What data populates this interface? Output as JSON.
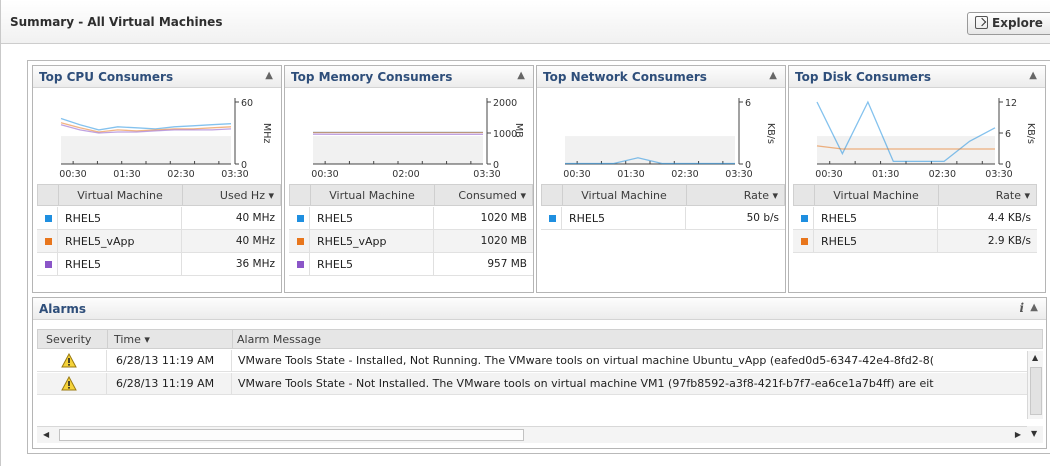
{
  "header": {
    "title": "Summary - All Virtual Machines",
    "explore_label": "Explore"
  },
  "panels": [
    {
      "title": "Top CPU Consumers",
      "col1": "Virtual Machine",
      "col2": "Used Hz ▾",
      "rows": [
        {
          "name": "RHEL5",
          "value": "40 MHz",
          "color": "#1f8fe0"
        },
        {
          "name": "RHEL5_vApp",
          "value": "40 MHz",
          "color": "#e8761d"
        },
        {
          "name": "RHEL5",
          "value": "36 MHz",
          "color": "#8b56c8"
        }
      ]
    },
    {
      "title": "Top Memory Consumers",
      "col1": "Virtual Machine",
      "col2": "Consumed ▾",
      "rows": [
        {
          "name": "RHEL5",
          "value": "1020 MB",
          "color": "#1f8fe0"
        },
        {
          "name": "RHEL5_vApp",
          "value": "1020 MB",
          "color": "#e8761d"
        },
        {
          "name": "RHEL5",
          "value": "957 MB",
          "color": "#8b56c8"
        }
      ]
    },
    {
      "title": "Top Network Consumers",
      "col1": "Virtual Machine",
      "col2": "Rate ▾",
      "rows": [
        {
          "name": "RHEL5",
          "value": "50 b/s",
          "color": "#1f8fe0"
        }
      ]
    },
    {
      "title": "Top Disk Consumers",
      "col1": "Virtual Machine",
      "col2": "Rate ▾",
      "rows": [
        {
          "name": "RHEL5",
          "value": "4.4 KB/s",
          "color": "#1f8fe0"
        },
        {
          "name": "RHEL5",
          "value": "2.9 KB/s",
          "color": "#e8761d"
        }
      ]
    }
  ],
  "chart_data": [
    {
      "type": "line",
      "x": [
        "00:15",
        "00:30",
        "00:45",
        "01:00",
        "01:30",
        "02:00",
        "02:30",
        "03:00",
        "03:30",
        "03:45"
      ],
      "xticks": [
        "00:30",
        "01:30",
        "02:30",
        "03:30"
      ],
      "ylabel": "MHz",
      "ylim": [
        0,
        60
      ],
      "yticks": [
        "60",
        "0"
      ],
      "series": [
        {
          "color": "#1f8fe0",
          "values": [
            44,
            38,
            33,
            36,
            35,
            34,
            36,
            37,
            38,
            39
          ]
        },
        {
          "color": "#e8761d",
          "values": [
            40,
            35,
            31,
            33,
            32,
            33,
            34,
            34,
            35,
            36
          ]
        },
        {
          "color": "#8b56c8",
          "values": [
            38,
            33,
            30,
            31,
            31,
            32,
            33,
            33,
            33,
            34
          ]
        }
      ]
    },
    {
      "type": "line",
      "x": [
        "00:15",
        "00:30",
        "01:00",
        "01:30",
        "02:00",
        "02:30",
        "03:00",
        "03:30"
      ],
      "xticks": [
        "00:30",
        "02:00",
        "03:30"
      ],
      "ylabel": "MB",
      "ylim": [
        0,
        2000
      ],
      "yticks": [
        "2000",
        "1000",
        "0"
      ],
      "series": [
        {
          "color": "#1f8fe0",
          "values": [
            1020,
            1020,
            1020,
            1020,
            1020,
            1020,
            1020,
            1020
          ]
        },
        {
          "color": "#e8761d",
          "values": [
            1015,
            1015,
            1015,
            1015,
            1015,
            1015,
            1015,
            1015
          ]
        },
        {
          "color": "#8b56c8",
          "values": [
            960,
            958,
            957,
            957,
            957,
            957,
            957,
            957
          ]
        }
      ]
    },
    {
      "type": "line",
      "x": [
        "00:15",
        "00:30",
        "01:00",
        "01:30",
        "02:00",
        "02:30",
        "03:00",
        "03:30"
      ],
      "xticks": [
        "00:30",
        "01:30",
        "02:30",
        "03:30"
      ],
      "ylabel": "KB/s",
      "ylim": [
        0,
        6
      ],
      "yticks": [
        "6",
        "0"
      ],
      "series": [
        {
          "color": "#1f8fe0",
          "values": [
            0.05,
            0.05,
            0.05,
            0.6,
            0.05,
            0.05,
            0.05,
            0.05
          ]
        }
      ]
    },
    {
      "type": "line",
      "x": [
        "00:15",
        "00:30",
        "01:00",
        "01:30",
        "02:00",
        "02:30",
        "03:00",
        "03:30"
      ],
      "xticks": [
        "00:30",
        "01:30",
        "02:30",
        "03:30"
      ],
      "ylabel": "KB/s",
      "ylim": [
        0,
        12
      ],
      "yticks": [
        "12",
        "6",
        "0"
      ],
      "series": [
        {
          "color": "#1f8fe0",
          "values": [
            12,
            2,
            12,
            0.5,
            0.5,
            0.5,
            4.4,
            7
          ]
        },
        {
          "color": "#e8761d",
          "values": [
            3.5,
            2.9,
            2.9,
            2.9,
            2.9,
            2.9,
            2.9,
            2.9
          ]
        }
      ]
    }
  ],
  "alarms": {
    "title": "Alarms",
    "info_label": "i",
    "columns": [
      "Severity",
      "Time ▾",
      "Alarm Message"
    ],
    "rows": [
      {
        "severity": "warning",
        "time": "6/28/13 11:19 AM",
        "message": "VMware Tools State - Installed, Not Running. The VMware tools on virtual machine Ubuntu_vApp (eafed0d5-6347-42e4-8fd2-8("
      },
      {
        "severity": "warning",
        "time": "6/28/13 11:19 AM",
        "message": "VMware Tools State - Not Installed. The VMware tools on virtual machine VM1 (97fb8592-a3f8-421f-b7f7-ea6ce1a7b4ff) are eit"
      }
    ]
  }
}
